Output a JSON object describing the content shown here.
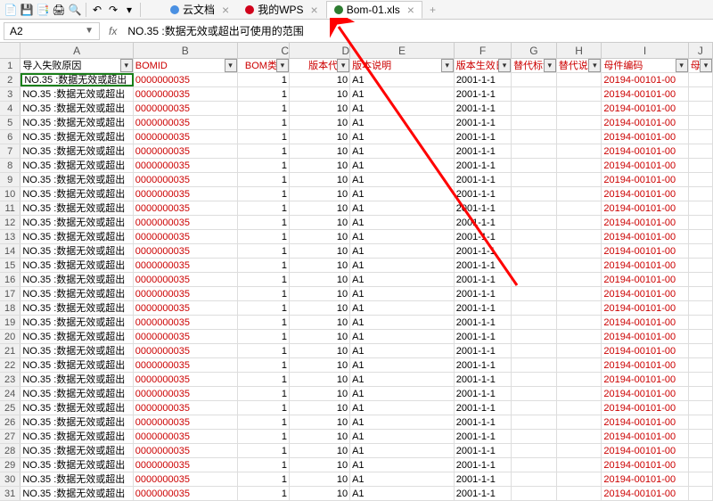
{
  "toolbar": {
    "icons": [
      "new",
      "save",
      "saveAs",
      "print",
      "preview",
      "undo",
      "redo"
    ]
  },
  "tabs": {
    "t1": "云文档",
    "t2": "我的WPS",
    "t3": "Bom-01.xls"
  },
  "namebox": "A2",
  "fx": "fx",
  "formula": "NO.35 :数据无效或超出可使用的范围",
  "cols": {
    "A": "A",
    "B": "B",
    "C": "C",
    "D": "D",
    "E": "E",
    "F": "F",
    "G": "G",
    "H": "H",
    "I": "I",
    "J": "J"
  },
  "headers": {
    "A": "导入失败原因",
    "B": "BOMID",
    "C": "BOM类别",
    "D": "版本代号",
    "E": "版本说明",
    "F": "版本生效日",
    "G": "替代标识",
    "H": "替代说明",
    "I": "母件编码",
    "J": "母件"
  },
  "vals": {
    "A": "NO.35 :数据无效或超出",
    "B": "0000000035",
    "C": "1",
    "D": "10",
    "E": "A1",
    "F": "2001-1-1",
    "I": "20194-00101-00"
  },
  "rowCount": 30
}
